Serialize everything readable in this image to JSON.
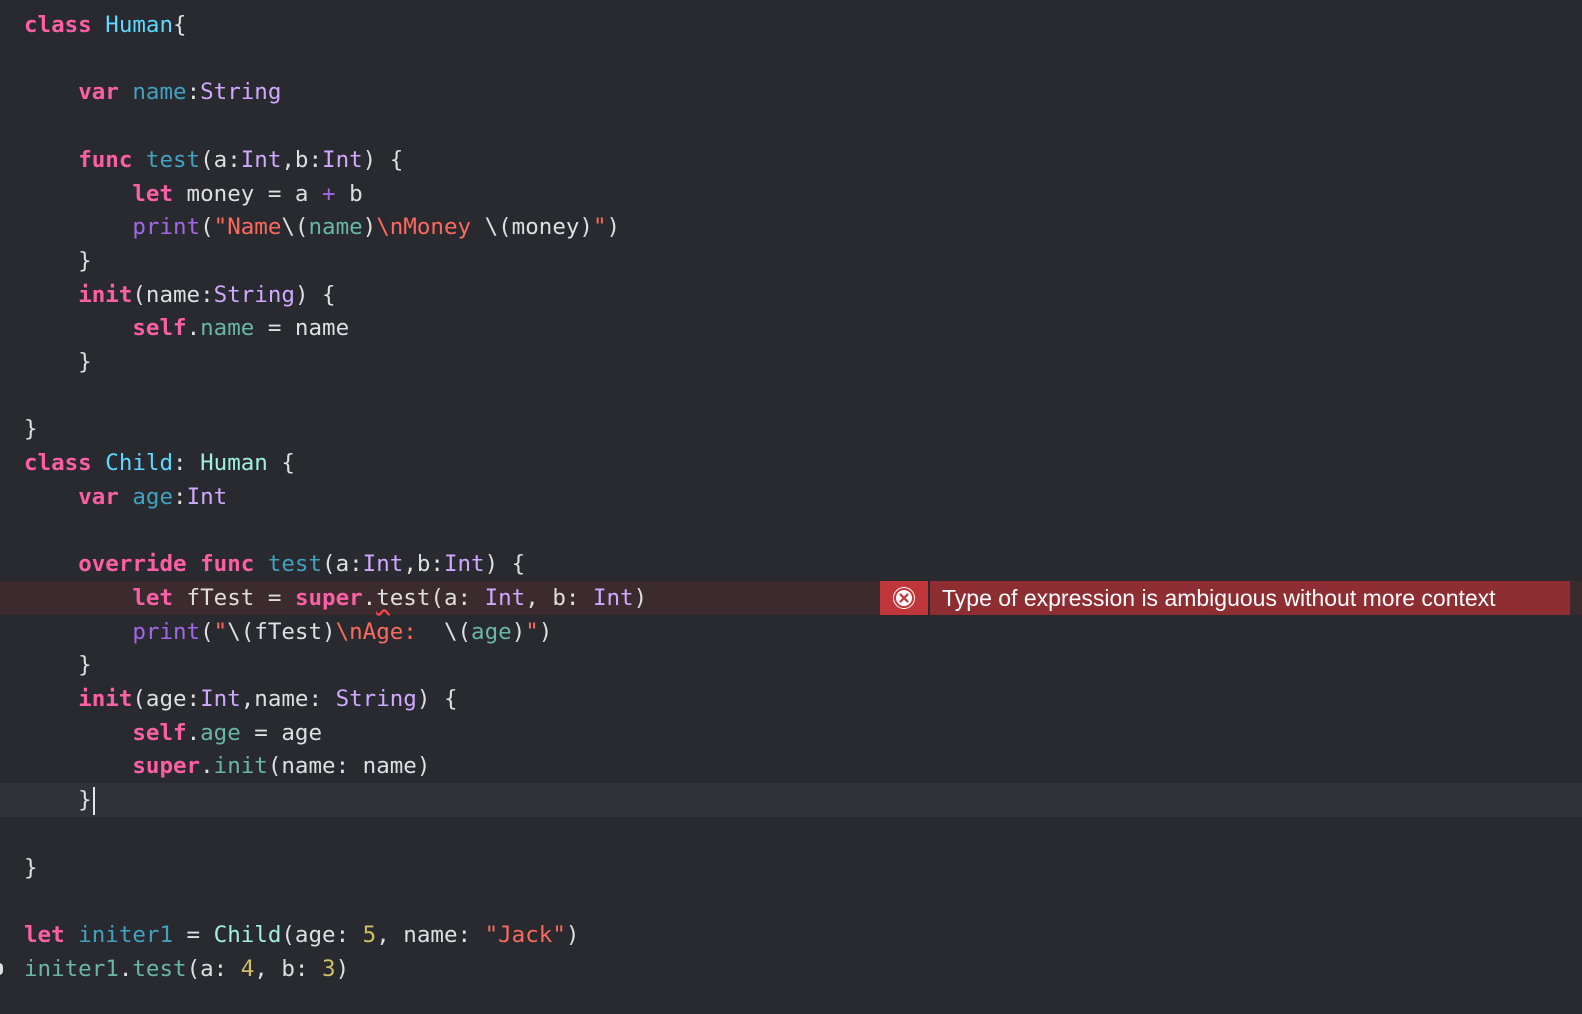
{
  "editor": {
    "error": {
      "message": "Type of expression is ambiguous without more context",
      "icon": "error-x-circle-icon"
    },
    "lines": [
      {
        "tokens": [
          {
            "t": "class",
            "c": "kw"
          },
          {
            "t": " ",
            "c": "plain"
          },
          {
            "t": "Human",
            "c": "decl"
          },
          {
            "t": "{",
            "c": "plain"
          }
        ]
      },
      {
        "tokens": []
      },
      {
        "tokens": [
          {
            "t": "    ",
            "c": "plain"
          },
          {
            "t": "var",
            "c": "kw"
          },
          {
            "t": " ",
            "c": "plain"
          },
          {
            "t": "name",
            "c": "prop"
          },
          {
            "t": ":",
            "c": "plain"
          },
          {
            "t": "String",
            "c": "type"
          }
        ]
      },
      {
        "tokens": []
      },
      {
        "tokens": [
          {
            "t": "    ",
            "c": "plain"
          },
          {
            "t": "func",
            "c": "kw"
          },
          {
            "t": " ",
            "c": "plain"
          },
          {
            "t": "test",
            "c": "prop"
          },
          {
            "t": "(a:",
            "c": "plain"
          },
          {
            "t": "Int",
            "c": "type"
          },
          {
            "t": ",b:",
            "c": "plain"
          },
          {
            "t": "Int",
            "c": "type"
          },
          {
            "t": ") {",
            "c": "plain"
          }
        ]
      },
      {
        "tokens": [
          {
            "t": "        ",
            "c": "plain"
          },
          {
            "t": "let",
            "c": "kw"
          },
          {
            "t": " money = a ",
            "c": "plain"
          },
          {
            "t": "+",
            "c": "fn"
          },
          {
            "t": " b",
            "c": "plain"
          }
        ]
      },
      {
        "tokens": [
          {
            "t": "        ",
            "c": "plain"
          },
          {
            "t": "print",
            "c": "fn"
          },
          {
            "t": "(",
            "c": "plain"
          },
          {
            "t": "\"Name",
            "c": "str"
          },
          {
            "t": "\\(",
            "c": "plain"
          },
          {
            "t": "name",
            "c": "pvar"
          },
          {
            "t": ")",
            "c": "plain"
          },
          {
            "t": "\\nMoney ",
            "c": "str"
          },
          {
            "t": "\\(money)",
            "c": "plain"
          },
          {
            "t": "\"",
            "c": "str"
          },
          {
            "t": ")",
            "c": "plain"
          }
        ]
      },
      {
        "tokens": [
          {
            "t": "    }",
            "c": "plain"
          }
        ]
      },
      {
        "tokens": [
          {
            "t": "    ",
            "c": "plain"
          },
          {
            "t": "init",
            "c": "kw"
          },
          {
            "t": "(name:",
            "c": "plain"
          },
          {
            "t": "String",
            "c": "type"
          },
          {
            "t": ") {",
            "c": "plain"
          }
        ]
      },
      {
        "tokens": [
          {
            "t": "        ",
            "c": "plain"
          },
          {
            "t": "self",
            "c": "kw"
          },
          {
            "t": ".",
            "c": "plain"
          },
          {
            "t": "name",
            "c": "pvar"
          },
          {
            "t": " = name",
            "c": "plain"
          }
        ]
      },
      {
        "tokens": [
          {
            "t": "    }",
            "c": "plain"
          }
        ]
      },
      {
        "tokens": []
      },
      {
        "tokens": [
          {
            "t": "}",
            "c": "plain"
          }
        ]
      },
      {
        "tokens": [
          {
            "t": "class",
            "c": "kw"
          },
          {
            "t": " ",
            "c": "plain"
          },
          {
            "t": "Child",
            "c": "decl"
          },
          {
            "t": ": ",
            "c": "plain"
          },
          {
            "t": "Human",
            "c": "usertype"
          },
          {
            "t": " {",
            "c": "plain"
          }
        ]
      },
      {
        "tokens": [
          {
            "t": "    ",
            "c": "plain"
          },
          {
            "t": "var",
            "c": "kw"
          },
          {
            "t": " ",
            "c": "plain"
          },
          {
            "t": "age",
            "c": "prop"
          },
          {
            "t": ":",
            "c": "plain"
          },
          {
            "t": "Int",
            "c": "type"
          }
        ]
      },
      {
        "tokens": []
      },
      {
        "tokens": [
          {
            "t": "    ",
            "c": "plain"
          },
          {
            "t": "override",
            "c": "kw"
          },
          {
            "t": " ",
            "c": "plain"
          },
          {
            "t": "func",
            "c": "kw"
          },
          {
            "t": " ",
            "c": "plain"
          },
          {
            "t": "test",
            "c": "prop"
          },
          {
            "t": "(a:",
            "c": "plain"
          },
          {
            "t": "Int",
            "c": "type"
          },
          {
            "t": ",b:",
            "c": "plain"
          },
          {
            "t": "Int",
            "c": "type"
          },
          {
            "t": ") {",
            "c": "plain"
          }
        ]
      },
      {
        "state": "error",
        "tokens": [
          {
            "t": "        ",
            "c": "plain"
          },
          {
            "t": "let",
            "c": "kw"
          },
          {
            "t": " fTest = ",
            "c": "plain"
          },
          {
            "t": "super",
            "c": "kw"
          },
          {
            "t": ".",
            "c": "plain"
          },
          {
            "t": "t",
            "c": "plain",
            "squiggle": true
          },
          {
            "t": "est(a: ",
            "c": "plain"
          },
          {
            "t": "Int",
            "c": "type"
          },
          {
            "t": ", b: ",
            "c": "plain"
          },
          {
            "t": "Int",
            "c": "type"
          },
          {
            "t": ")",
            "c": "plain"
          }
        ]
      },
      {
        "tokens": [
          {
            "t": "        ",
            "c": "plain"
          },
          {
            "t": "print",
            "c": "fn"
          },
          {
            "t": "(",
            "c": "plain"
          },
          {
            "t": "\"",
            "c": "str"
          },
          {
            "t": "\\(fTest)",
            "c": "plain"
          },
          {
            "t": "\\nAge:  ",
            "c": "str"
          },
          {
            "t": "\\(",
            "c": "plain"
          },
          {
            "t": "age",
            "c": "pvar"
          },
          {
            "t": ")",
            "c": "plain"
          },
          {
            "t": "\"",
            "c": "str"
          },
          {
            "t": ")",
            "c": "plain"
          }
        ]
      },
      {
        "tokens": [
          {
            "t": "    }",
            "c": "plain"
          }
        ]
      },
      {
        "tokens": [
          {
            "t": "    ",
            "c": "plain"
          },
          {
            "t": "init",
            "c": "kw"
          },
          {
            "t": "(age:",
            "c": "plain"
          },
          {
            "t": "Int",
            "c": "type"
          },
          {
            "t": ",name: ",
            "c": "plain"
          },
          {
            "t": "String",
            "c": "type"
          },
          {
            "t": ") {",
            "c": "plain"
          }
        ]
      },
      {
        "tokens": [
          {
            "t": "        ",
            "c": "plain"
          },
          {
            "t": "self",
            "c": "kw"
          },
          {
            "t": ".",
            "c": "plain"
          },
          {
            "t": "age",
            "c": "pvar"
          },
          {
            "t": " = age",
            "c": "plain"
          }
        ]
      },
      {
        "tokens": [
          {
            "t": "        ",
            "c": "plain"
          },
          {
            "t": "super",
            "c": "kw"
          },
          {
            "t": ".",
            "c": "plain"
          },
          {
            "t": "init",
            "c": "ufn"
          },
          {
            "t": "(name: name)",
            "c": "plain"
          }
        ]
      },
      {
        "state": "current",
        "cursor": true,
        "tokens": [
          {
            "t": "    }",
            "c": "plain"
          }
        ]
      },
      {
        "tokens": []
      },
      {
        "tokens": [
          {
            "t": "}",
            "c": "plain"
          }
        ]
      },
      {
        "tokens": []
      },
      {
        "tokens": [
          {
            "t": "let",
            "c": "kw"
          },
          {
            "t": " ",
            "c": "plain"
          },
          {
            "t": "initer1",
            "c": "prop"
          },
          {
            "t": " = ",
            "c": "plain"
          },
          {
            "t": "Child",
            "c": "usertype"
          },
          {
            "t": "(age: ",
            "c": "plain"
          },
          {
            "t": "5",
            "c": "num"
          },
          {
            "t": ", name: ",
            "c": "plain"
          },
          {
            "t": "\"Jack\"",
            "c": "str"
          },
          {
            "t": ")",
            "c": "plain"
          }
        ]
      },
      {
        "tokens": [
          {
            "t": "initer1",
            "c": "pvar"
          },
          {
            "t": ".",
            "c": "plain"
          },
          {
            "t": "test",
            "c": "ufn"
          },
          {
            "t": "(a: ",
            "c": "plain"
          },
          {
            "t": "4",
            "c": "num"
          },
          {
            "t": ", b: ",
            "c": "plain"
          },
          {
            "t": "3",
            "c": "num"
          },
          {
            "t": ")",
            "c": "plain"
          }
        ]
      }
    ]
  }
}
